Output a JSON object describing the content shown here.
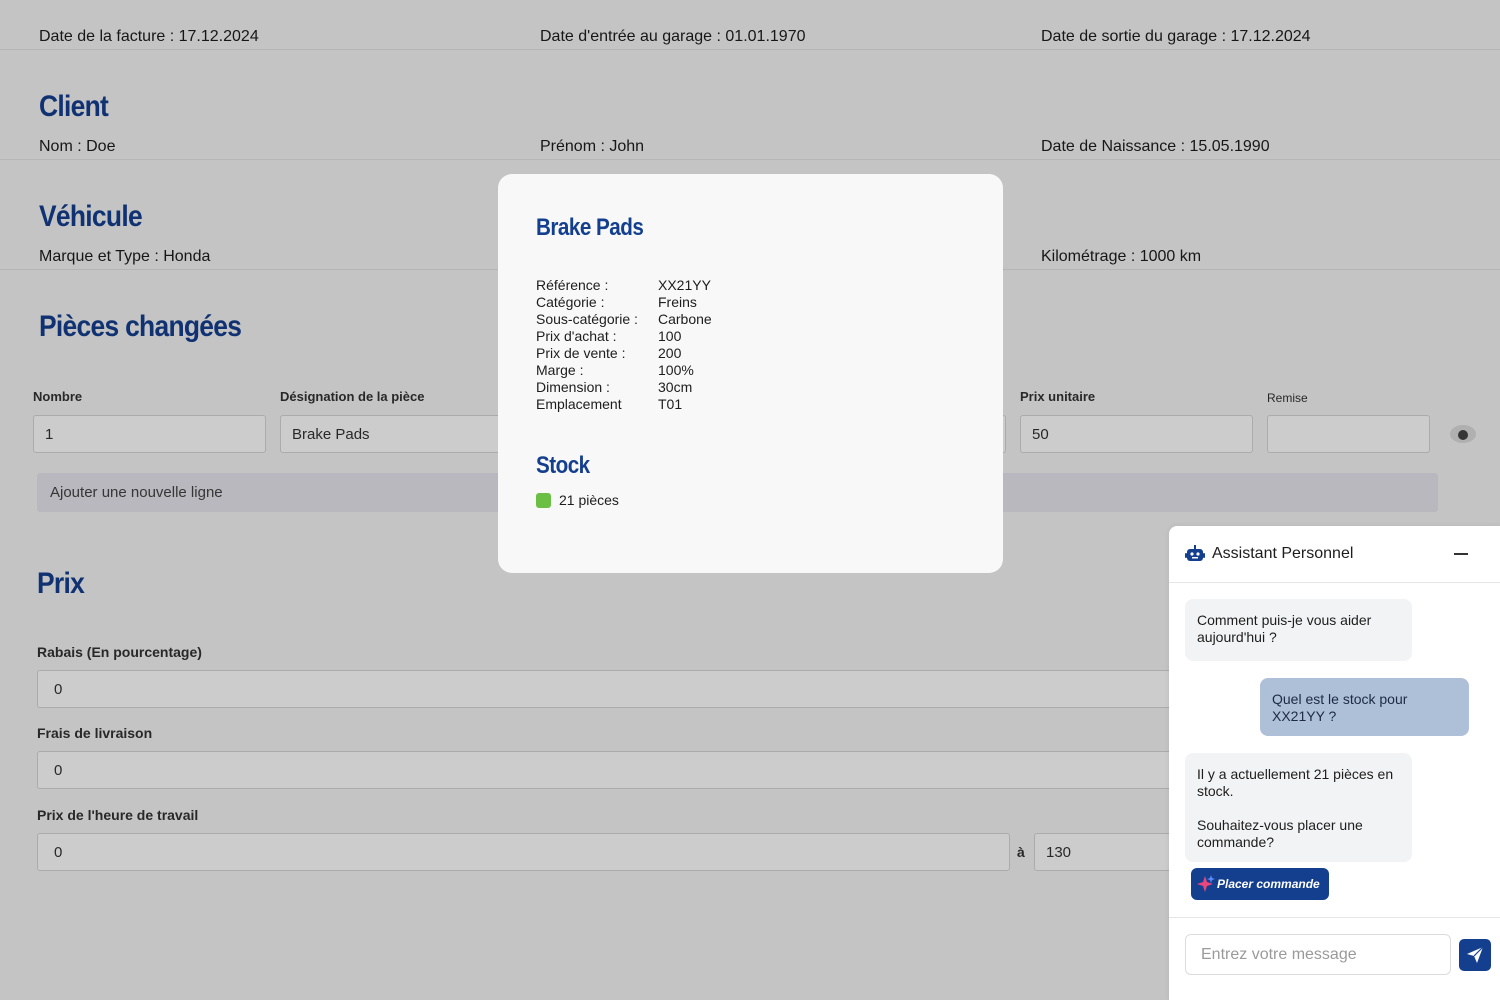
{
  "dates": {
    "invoice": "Date de la facture : 17.12.2024",
    "garage_in": "Date d'entrée au garage : 01.01.1970",
    "garage_out": "Date de sortie du garage : 17.12.2024"
  },
  "client": {
    "title": "Client",
    "nom": "Nom : Doe",
    "prenom": "Prénom : John",
    "naissance": "Date de Naissance : 15.05.1990"
  },
  "vehicule": {
    "title": "Véhicule",
    "marque": "Marque et Type : Honda",
    "km": "Kilométrage : 1000 km"
  },
  "pieces": {
    "title": "Pièces changées",
    "col_nombre": "Nombre",
    "col_designation": "Désignation de la pièce",
    "col_prix_unitaire": "Prix unitaire",
    "col_remise": "Remise",
    "row": {
      "nombre": "1",
      "designation": "Brake Pads",
      "prix_unitaire": "50",
      "remise": ""
    },
    "add_line": "Ajouter une nouvelle ligne"
  },
  "prix": {
    "title": "Prix",
    "rabais_label": "Rabais (En pourcentage)",
    "rabais_value": "0",
    "livraison_label": "Frais de livraison",
    "livraison_value": "0",
    "heure_label": "Prix de l'heure de travail",
    "heure_from": "0",
    "heure_sep": "à",
    "heure_to": "130"
  },
  "modal": {
    "title": "Brake Pads",
    "specs": [
      {
        "k": "Référence :",
        "v": "XX21YY"
      },
      {
        "k": "Catégorie :",
        "v": "Freins"
      },
      {
        "k": "Sous-catégorie :",
        "v": "Carbone"
      },
      {
        "k": "Prix d'achat :",
        "v": "100"
      },
      {
        "k": "Prix de vente :",
        "v": "200"
      },
      {
        "k": "Marge :",
        "v": "100%"
      },
      {
        "k": "Dimension :",
        "v": "30cm"
      },
      {
        "k": "Emplacement",
        "v": "T01"
      }
    ],
    "stock_title": "Stock",
    "stock_text": "21 pièces",
    "stock_color": "#6cbf45"
  },
  "chat": {
    "title": "Assistant Personnel",
    "messages": [
      {
        "from": "bot",
        "text": "Comment puis-je vous aider aujourd'hui ?"
      },
      {
        "from": "user",
        "text": "Quel est le stock pour XX21YY ?"
      },
      {
        "from": "bot",
        "text": "Il y a actuellement 21 pièces en stock.\n\nSouhaitez-vous placer une commande?"
      }
    ],
    "order_button": "Placer commande",
    "input_placeholder": "Entrez votre message"
  },
  "colors": {
    "brand": "#143f8f",
    "stock_ok": "#6cbf45"
  }
}
